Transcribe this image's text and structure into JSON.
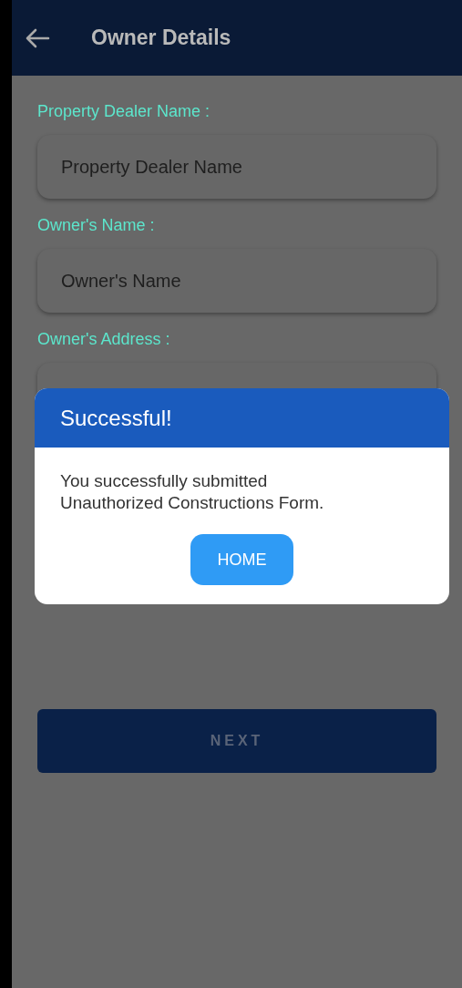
{
  "app_bar": {
    "title": "Owner Details"
  },
  "fields": [
    {
      "label": "Property Dealer Name :",
      "placeholder": "Property Dealer Name"
    },
    {
      "label": "Owner's Name :",
      "placeholder": "Owner's Name"
    },
    {
      "label": "Owner's Address :"
    }
  ],
  "next_button": {
    "label": "NEXT"
  },
  "dialog": {
    "title": "Successful!",
    "message": "You successfully submitted Unauthorized Constructions Form.",
    "button": "HOME"
  }
}
